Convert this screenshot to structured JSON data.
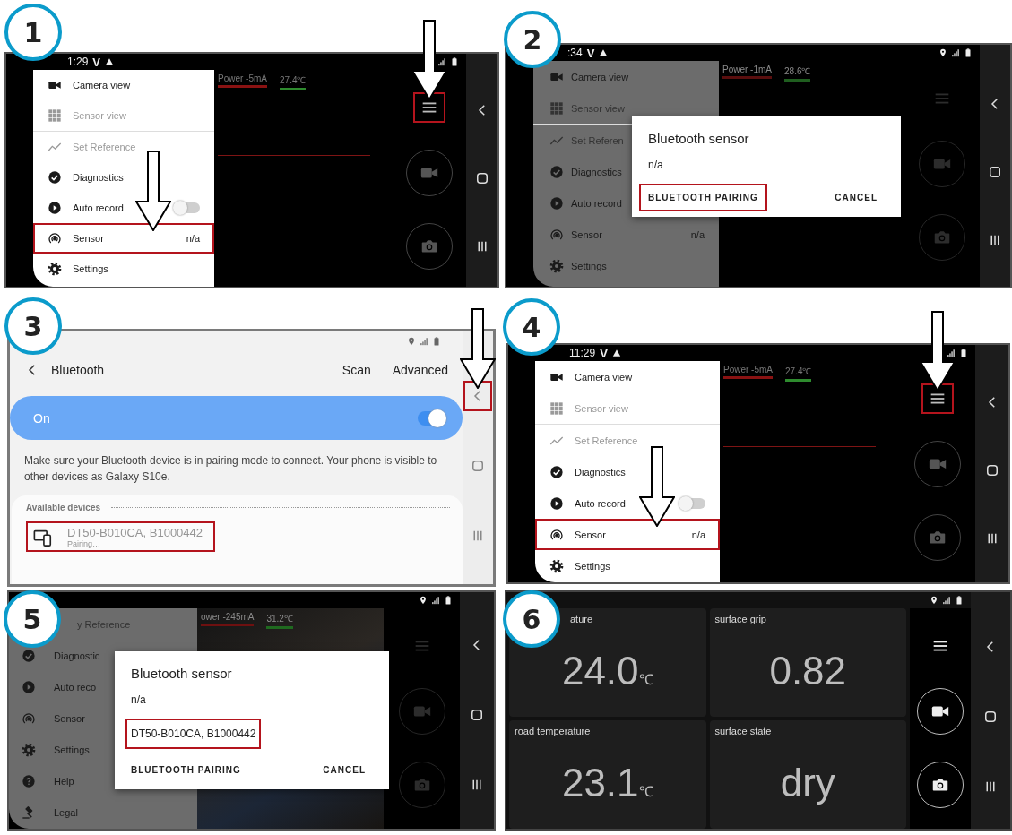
{
  "steps": [
    {
      "number": "1",
      "kind": "camera_menu",
      "photo_background": false,
      "status_bar": {
        "time": "1:29",
        "carrier": "V"
      },
      "readings": [
        {
          "text": "Power -5mA",
          "color": "#8a1212"
        },
        {
          "text": "27.4℃",
          "color": "#2e8b2e"
        }
      ],
      "menu_sections": [
        {
          "items": [
            {
              "kind": "camera",
              "label": "Camera view",
              "disabled": false,
              "boxed": false,
              "pointed": false
            },
            {
              "kind": "grid",
              "label": "Sensor view",
              "disabled": true,
              "boxed": false,
              "pointed": false
            }
          ]
        },
        {
          "items": [
            {
              "kind": "chart",
              "label": "Set Reference",
              "disabled": true,
              "boxed": false,
              "pointed": false
            },
            {
              "kind": "check",
              "label": "Diagnostics",
              "disabled": false,
              "boxed": false,
              "pointed": false
            },
            {
              "kind": "play",
              "label": "Auto record",
              "disabled": false,
              "boxed": false,
              "pointed": false,
              "toggle_on": false
            },
            {
              "kind": "sensor",
              "label": "Sensor",
              "value": "n/a",
              "disabled": false,
              "boxed": true,
              "pointed": true
            },
            {
              "kind": "settings",
              "label": "Settings",
              "disabled": false,
              "boxed": false,
              "pointed": false
            }
          ]
        }
      ],
      "rail": [
        {
          "kind": "menu",
          "boxed": true,
          "pointed": true
        },
        {
          "kind": "video",
          "boxed": false,
          "pointed": false
        },
        {
          "kind": "photo",
          "boxed": false,
          "pointed": false
        }
      ],
      "nav": [
        {
          "kind": "back",
          "boxed": false,
          "pointed": false
        },
        {
          "kind": "home",
          "boxed": false,
          "pointed": false
        },
        {
          "kind": "recents",
          "boxed": false,
          "pointed": false
        }
      ]
    },
    {
      "number": "2",
      "kind": "camera_menu",
      "photo_background": false,
      "status_bar": {
        "time": ":34",
        "carrier": "V"
      },
      "readings": [
        {
          "text": "Power -1mA",
          "color": "#5a0e0e"
        },
        {
          "text": "28.6℃",
          "color": "#1f5e1f"
        }
      ],
      "menu_sections": [
        {
          "items": [
            {
              "kind": "camera",
              "label": "Camera view",
              "disabled": false,
              "boxed": false,
              "pointed": false
            },
            {
              "kind": "grid",
              "label": "Sensor view",
              "disabled": true,
              "boxed": false,
              "pointed": false
            }
          ]
        },
        {
          "items": [
            {
              "kind": "chart",
              "label": "Set Referen",
              "disabled": true,
              "boxed": false,
              "pointed": false
            },
            {
              "kind": "check",
              "label": "Diagnostics",
              "disabled": false,
              "boxed": false,
              "pointed": false
            },
            {
              "kind": "play",
              "label": "Auto record",
              "disabled": false,
              "boxed": false,
              "pointed": false
            },
            {
              "kind": "sensor",
              "label": "Sensor",
              "value": "n/a",
              "disabled": false,
              "boxed": false,
              "pointed": false
            },
            {
              "kind": "settings",
              "label": "Settings",
              "disabled": false,
              "boxed": false,
              "pointed": false
            }
          ]
        }
      ],
      "dialog": {
        "title": "Bluetooth sensor",
        "lines": [
          {
            "text": "n/a",
            "boxed": false
          }
        ],
        "buttons": [
          {
            "label": "BLUETOOTH PAIRING",
            "boxed": true
          },
          {
            "label": "CANCEL",
            "boxed": false
          }
        ]
      },
      "rail": [
        {
          "kind": "menu",
          "boxed": false,
          "pointed": false
        },
        {
          "kind": "video",
          "boxed": false,
          "pointed": false
        },
        {
          "kind": "photo",
          "boxed": false,
          "pointed": false
        }
      ],
      "nav": [
        {
          "kind": "back",
          "boxed": false,
          "pointed": false
        },
        {
          "kind": "home",
          "boxed": false,
          "pointed": false
        },
        {
          "kind": "recents",
          "boxed": false,
          "pointed": false
        }
      ]
    },
    {
      "number": "3",
      "kind": "bluetooth_settings",
      "title": "Bluetooth",
      "actions": [
        "Scan",
        "Advanced"
      ],
      "switch": {
        "label": "On",
        "on": true
      },
      "description": "Make sure your Bluetooth device is in pairing mode to connect. Your phone is visible to other devices as Galaxy S10e.",
      "available": {
        "heading": "Available devices",
        "devices": [
          {
            "name": "DT50-B010CA, B1000442",
            "status": "Pairing…",
            "boxed": true
          }
        ]
      },
      "nav": [
        {
          "kind": "back",
          "boxed": true,
          "pointed": true
        },
        {
          "kind": "home",
          "boxed": false,
          "pointed": false
        },
        {
          "kind": "recents",
          "boxed": false,
          "pointed": false
        }
      ]
    },
    {
      "number": "4",
      "kind": "camera_menu",
      "photo_background": false,
      "status_bar": {
        "time": "11:29",
        "carrier": "V"
      },
      "readings": [
        {
          "text": "Power -5mA",
          "color": "#8a1212"
        },
        {
          "text": "27.4℃",
          "color": "#2e8b2e"
        }
      ],
      "menu_sections": [
        {
          "items": [
            {
              "kind": "camera",
              "label": "Camera view",
              "disabled": false,
              "boxed": false,
              "pointed": false
            },
            {
              "kind": "grid",
              "label": "Sensor view",
              "disabled": true,
              "boxed": false,
              "pointed": false
            }
          ]
        },
        {
          "items": [
            {
              "kind": "chart",
              "label": "Set Reference",
              "disabled": true,
              "boxed": false,
              "pointed": false
            },
            {
              "kind": "check",
              "label": "Diagnostics",
              "disabled": false,
              "boxed": false,
              "pointed": false
            },
            {
              "kind": "play",
              "label": "Auto record",
              "disabled": false,
              "boxed": false,
              "pointed": false,
              "toggle_on": false
            },
            {
              "kind": "sensor",
              "label": "Sensor",
              "value": "n/a",
              "disabled": false,
              "boxed": true,
              "pointed": true
            },
            {
              "kind": "settings",
              "label": "Settings",
              "disabled": false,
              "boxed": false,
              "pointed": false
            }
          ]
        }
      ],
      "rail": [
        {
          "kind": "menu",
          "boxed": true,
          "pointed": true
        },
        {
          "kind": "video",
          "boxed": false,
          "pointed": false
        },
        {
          "kind": "photo",
          "boxed": false,
          "pointed": false
        }
      ],
      "nav": [
        {
          "kind": "back",
          "boxed": false,
          "pointed": false
        },
        {
          "kind": "home",
          "boxed": false,
          "pointed": false
        },
        {
          "kind": "recents",
          "boxed": false,
          "pointed": false
        }
      ]
    },
    {
      "number": "5",
      "kind": "camera_menu",
      "photo_background": true,
      "readings": [
        {
          "text": "ower -245mA",
          "color": "#6e1010"
        },
        {
          "text": "31.2℃",
          "color": "#1f6a1f"
        }
      ],
      "menu_sections": [
        {
          "items": [
            {
              "label": "y Reference",
              "disabled": true,
              "boxed": false,
              "pointed": false
            },
            {
              "kind": "check",
              "label": "Diagnostic",
              "disabled": false,
              "boxed": false,
              "pointed": false
            },
            {
              "kind": "play",
              "label": "Auto reco",
              "disabled": false,
              "boxed": false,
              "pointed": false
            },
            {
              "kind": "sensor",
              "label": "Sensor",
              "disabled": false,
              "boxed": false,
              "pointed": false
            },
            {
              "kind": "settings",
              "label": "Settings",
              "disabled": false,
              "boxed": false,
              "pointed": false
            },
            {
              "kind": "help",
              "label": "Help",
              "disabled": false,
              "boxed": false,
              "pointed": false
            },
            {
              "kind": "legal",
              "label": "Legal",
              "disabled": false,
              "boxed": false,
              "pointed": false
            }
          ]
        }
      ],
      "dialog": {
        "title": "Bluetooth sensor",
        "lines": [
          {
            "text": "n/a",
            "boxed": false
          },
          {
            "text": "DT50-B010CA, B1000442",
            "boxed": true
          }
        ],
        "buttons": [
          {
            "label": "BLUETOOTH PAIRING",
            "boxed": false
          },
          {
            "label": "CANCEL",
            "boxed": false
          }
        ]
      },
      "rail": [
        {
          "kind": "menu",
          "boxed": false,
          "pointed": false
        },
        {
          "kind": "video",
          "boxed": false,
          "pointed": false
        },
        {
          "kind": "photo",
          "boxed": false,
          "pointed": false
        }
      ],
      "nav": [
        {
          "kind": "back",
          "boxed": false,
          "pointed": false
        },
        {
          "kind": "home",
          "boxed": false,
          "pointed": false
        },
        {
          "kind": "recents",
          "boxed": false,
          "pointed": false
        }
      ]
    },
    {
      "number": "6",
      "kind": "sensor_dashboard",
      "tiles": [
        {
          "label": "ature",
          "value": "24.0",
          "unit": "℃"
        },
        {
          "label": "surface grip",
          "value": "0.82"
        },
        {
          "label": "road temperature",
          "value": "23.1",
          "unit": "℃"
        },
        {
          "label": "surface state",
          "value": "dry"
        }
      ],
      "rail": [
        {
          "kind": "menu",
          "boxed": false,
          "pointed": false
        },
        {
          "kind": "video",
          "boxed": false,
          "pointed": false
        },
        {
          "kind": "photo",
          "boxed": false,
          "pointed": false
        }
      ],
      "nav": [
        {
          "kind": "back",
          "boxed": false,
          "pointed": false
        },
        {
          "kind": "home",
          "boxed": false,
          "pointed": false
        },
        {
          "kind": "recents",
          "boxed": false,
          "pointed": false
        }
      ]
    }
  ]
}
